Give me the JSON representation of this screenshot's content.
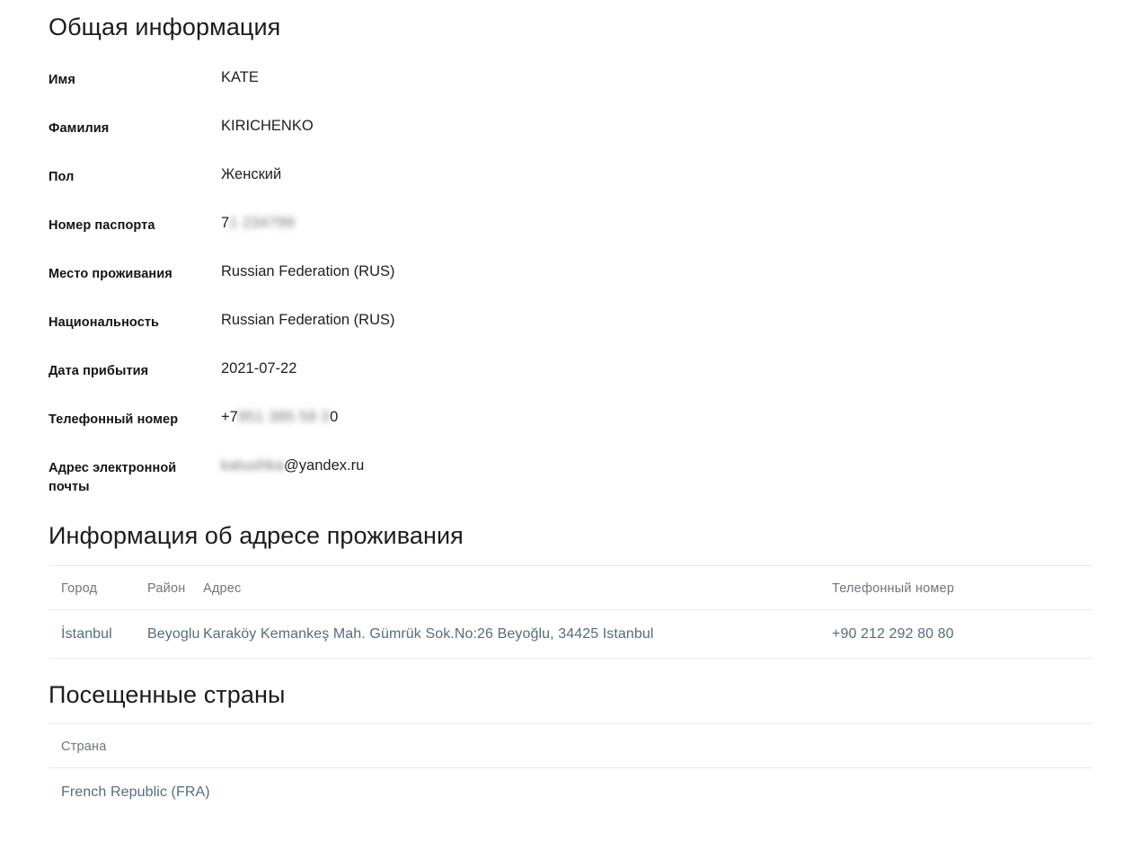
{
  "general": {
    "title": "Общая информация",
    "rows": [
      {
        "label": "Имя",
        "value": "KATE",
        "redacted_prefix": "",
        "redacted_text": "",
        "redacted_suffix": ""
      },
      {
        "label": "Фамилия",
        "value": "KIRICHENKO",
        "redacted_prefix": "",
        "redacted_text": "",
        "redacted_suffix": ""
      },
      {
        "label": "Пол",
        "value": "Женский",
        "redacted_prefix": "",
        "redacted_text": "",
        "redacted_suffix": ""
      },
      {
        "label": "Номер паспорта",
        "value": "",
        "redacted_prefix": "7",
        "redacted_text": "1 234799",
        "redacted_suffix": ""
      },
      {
        "label": "Место проживания",
        "value": "Russian Federation (RUS)",
        "redacted_prefix": "",
        "redacted_text": "",
        "redacted_suffix": ""
      },
      {
        "label": "Национальность",
        "value": "Russian Federation (RUS)",
        "redacted_prefix": "",
        "redacted_text": "",
        "redacted_suffix": ""
      },
      {
        "label": "Дата прибытия",
        "value": "2021-07-22",
        "redacted_prefix": "",
        "redacted_text": "",
        "redacted_suffix": ""
      },
      {
        "label": "Телефонный номер",
        "value": "",
        "redacted_prefix": "+7 ",
        "redacted_text": "951 385 59 3",
        "redacted_suffix": "0"
      },
      {
        "label": "Адрес электронной почты",
        "value": "",
        "redacted_prefix": "",
        "redacted_text": "katushka",
        "redacted_suffix": "@yandex.ru"
      }
    ]
  },
  "address_section": {
    "title": "Информация об адресе проживания",
    "columns": [
      "Город",
      "Район",
      "Адрес",
      "Телефонный номер"
    ],
    "rows": [
      {
        "city": "İstanbul",
        "district": "Beyoglu",
        "address": "Karaköy Kemankeş Mah. Gümrük Sok.No:26 Beyoğlu, 34425 Istanbul",
        "phone": "+90 212 292 80 80"
      }
    ]
  },
  "countries_section": {
    "title": "Посещенные страны",
    "columns": [
      "Страна"
    ],
    "rows": [
      {
        "country": "French Republic (FRA)"
      }
    ]
  },
  "colors": {
    "background": "#ffffff",
    "heading": "#1c1c1c",
    "label": "#141414",
    "value": "#1f1f1f",
    "table_header": "#70757a",
    "table_cell": "#546e7a",
    "divider": "#e8eaed"
  }
}
